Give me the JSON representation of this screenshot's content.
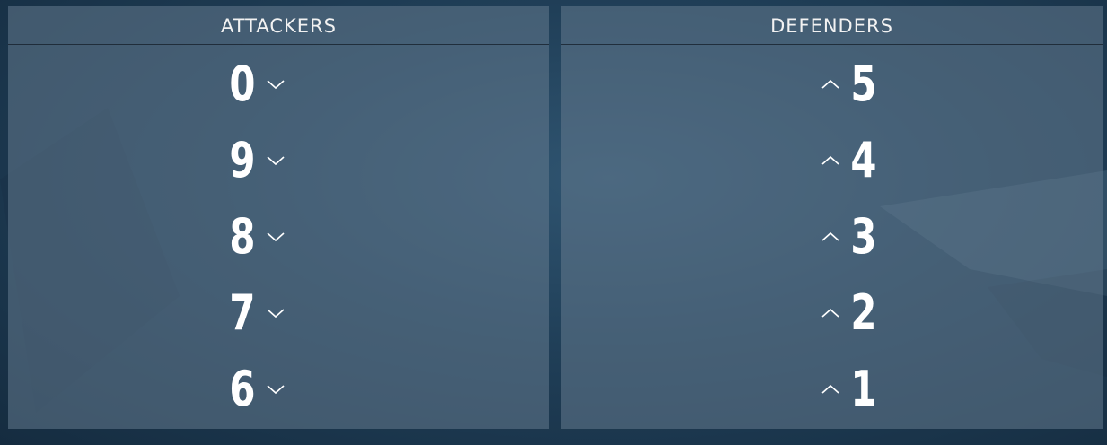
{
  "attackers": {
    "title": "ATTACKERS",
    "rows": [
      {
        "value": "0",
        "icon": "chevron-down-icon"
      },
      {
        "value": "9",
        "icon": "chevron-down-icon"
      },
      {
        "value": "8",
        "icon": "chevron-down-icon"
      },
      {
        "value": "7",
        "icon": "chevron-down-icon"
      },
      {
        "value": "6",
        "icon": "chevron-down-icon"
      }
    ]
  },
  "defenders": {
    "title": "DEFENDERS",
    "rows": [
      {
        "value": "5",
        "icon": "chevron-up-icon"
      },
      {
        "value": "4",
        "icon": "chevron-up-icon"
      },
      {
        "value": "3",
        "icon": "chevron-up-icon"
      },
      {
        "value": "2",
        "icon": "chevron-up-icon"
      },
      {
        "value": "1",
        "icon": "chevron-up-icon"
      }
    ]
  },
  "colors": {
    "panel": "#5f7a90",
    "text": "#ffffff",
    "background": "#1f3c54"
  }
}
